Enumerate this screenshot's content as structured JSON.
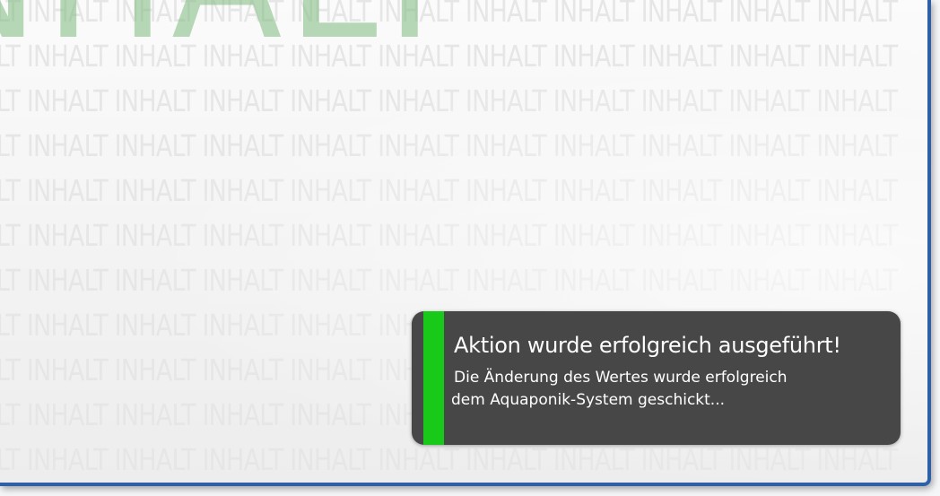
{
  "background": {
    "watermark_text": "INHALT INHALT INHALT INHALT INHALT INHALT INHALT INHALT INHALT INHALT INHALT",
    "title_text": "INHALT",
    "title_color": "#7eba7e",
    "frame_color": "#2f5fa9"
  },
  "toast": {
    "title": "Aktion wurde erfolgreich ausgeführt!",
    "message_line1": "Die Änderung des Wertes wurde erfolgreich",
    "message_line2": "dem Aquaponik-System geschickt...",
    "status": "success",
    "accent_color": "#19c919",
    "background_color": "#474747"
  }
}
